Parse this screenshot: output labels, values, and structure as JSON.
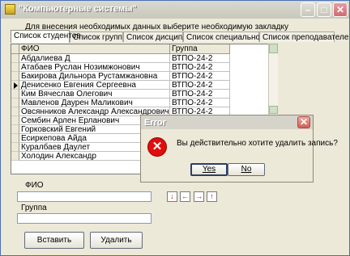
{
  "window": {
    "title": "\"Компьютерные системы\"",
    "minimize_glyph": "–",
    "maximize_glyph": "□",
    "close_glyph": "✕"
  },
  "hint": "Для внесения необходимых данных выберите необходимую закладку",
  "tabs": [
    {
      "label": "Список студентов",
      "active": true
    },
    {
      "label": "Список групп",
      "active": false
    },
    {
      "label": "Список дисциплин",
      "active": false
    },
    {
      "label": "Список специальностей",
      "active": false
    },
    {
      "label": "Список преподавателей",
      "active": false
    }
  ],
  "grid": {
    "columns": [
      "ФИО",
      "Группа"
    ],
    "rows": [
      {
        "fio": "Абдалиева Д",
        "group": "ВТПО-24-2",
        "current": false
      },
      {
        "fio": "Атабаев Руслан Нозимжонович",
        "group": "ВТПО-24-2",
        "current": false
      },
      {
        "fio": "Бакирова Дильнора Рустамжановна",
        "group": "ВТПО-24-2",
        "current": false
      },
      {
        "fio": "Денисенко Евгения Сергеевна",
        "group": "ВТПО-24-2",
        "current": true
      },
      {
        "fio": "Ким Вячеслав Олегович",
        "group": "ВТПО-24-2",
        "current": false
      },
      {
        "fio": "Мавленов Даурен Маликович",
        "group": "ВТПО-24-2",
        "current": false
      },
      {
        "fio": "Овсянников Александр Александрович",
        "group": "ВТПО-24-2",
        "current": false
      },
      {
        "fio": "Сембин Арлен Ерланович",
        "group": "",
        "current": false
      },
      {
        "fio": "Горковский Евгений",
        "group": "",
        "current": false
      },
      {
        "fio": "Есиркепова Айда",
        "group": "",
        "current": false
      },
      {
        "fio": "Куралбаев Даулет",
        "group": "",
        "current": false
      },
      {
        "fio": "Холодин Александр",
        "group": "",
        "current": false
      }
    ]
  },
  "form": {
    "fio_label": "ФИО",
    "fio_value": "",
    "group_label": "Группа",
    "group_value": ""
  },
  "nav_buttons": [
    {
      "glyph": "↓",
      "icon": "arrow-down-icon"
    },
    {
      "glyph": "←",
      "icon": "arrow-left-icon"
    },
    {
      "glyph": "→",
      "icon": "arrow-right-icon"
    },
    {
      "glyph": "↑",
      "icon": "arrow-up-icon"
    }
  ],
  "buttons": {
    "insert": "Вставить",
    "delete": "Удалить"
  },
  "dialog": {
    "title": "Error",
    "close_glyph": "✕",
    "icon_glyph": "✕",
    "message": "Вы действительно хотите удалить запись?",
    "yes": "Yes",
    "no": "No"
  }
}
